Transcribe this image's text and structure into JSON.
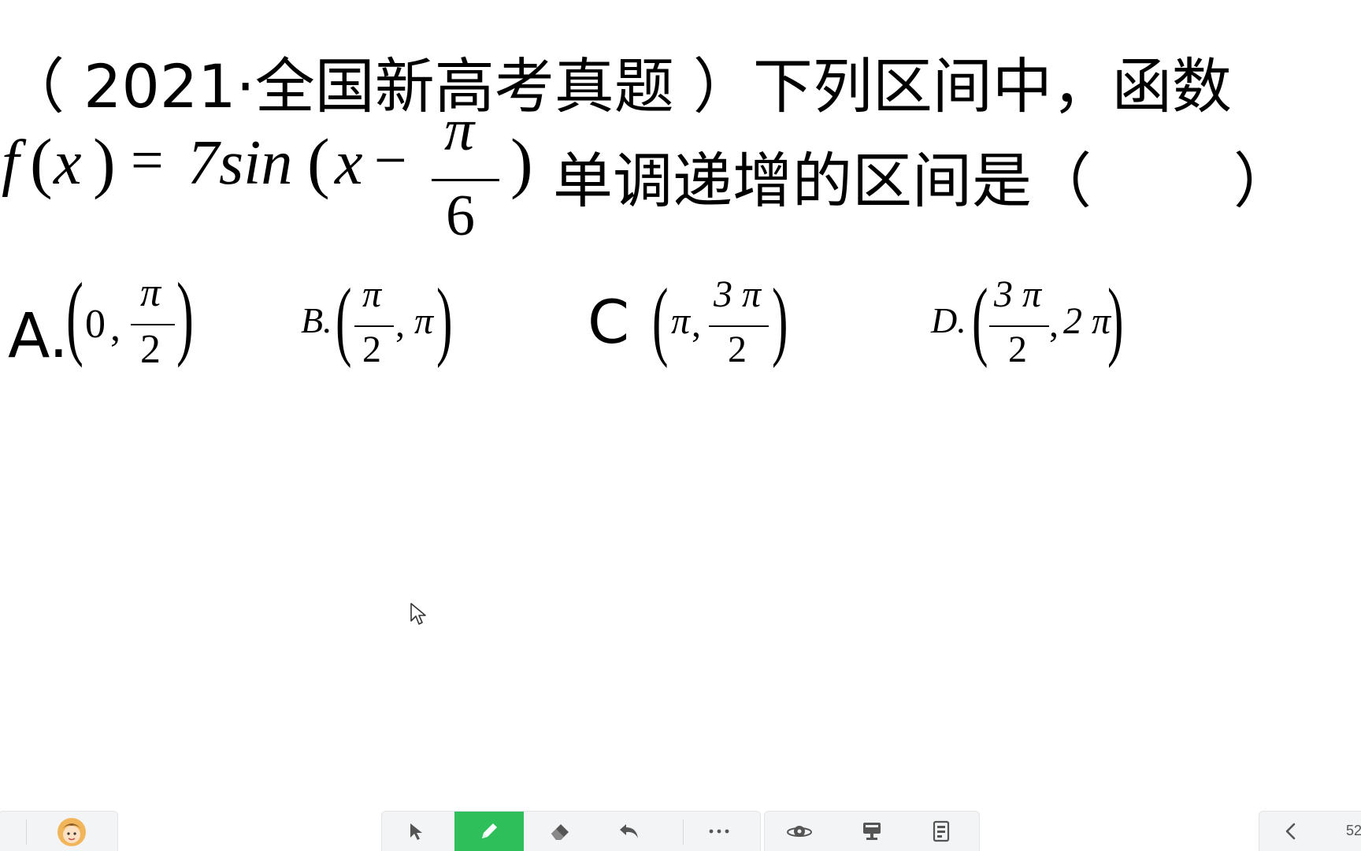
{
  "question": {
    "line1": "（ 2021·全国新高考真题 ）下列区间中，函数",
    "func_f": "f",
    "func_x": "x",
    "func_eq": "=",
    "func_coef": "7",
    "func_name": "sin",
    "func_var": "x",
    "func_minus": "−",
    "func_frac_num": "π",
    "func_frac_den": "6",
    "line2_text": "单调递增的区间是（",
    "line2_close": "）"
  },
  "options": {
    "a": {
      "label": "A.",
      "first_is_frac": false,
      "first": "0",
      "second_num": "π",
      "second_den": "2"
    },
    "b": {
      "label": "B.",
      "first_num": "π",
      "first_den": "2",
      "second": "π"
    },
    "c": {
      "label": "C",
      "first": "π",
      "second_num": "3 π",
      "second_den": "2"
    },
    "d": {
      "label": "D.",
      "first_num": "3 π",
      "first_den": "2",
      "second": "2 π"
    }
  },
  "toolbar": {
    "page_number": "52",
    "accent": "#2fbf5a",
    "tools": [
      "avatar",
      "pointer-icon",
      "pen-icon",
      "eraser-icon",
      "undo-icon",
      "more-icon",
      "spin-icon",
      "presenter-icon",
      "page-icon",
      "prev-icon"
    ]
  }
}
